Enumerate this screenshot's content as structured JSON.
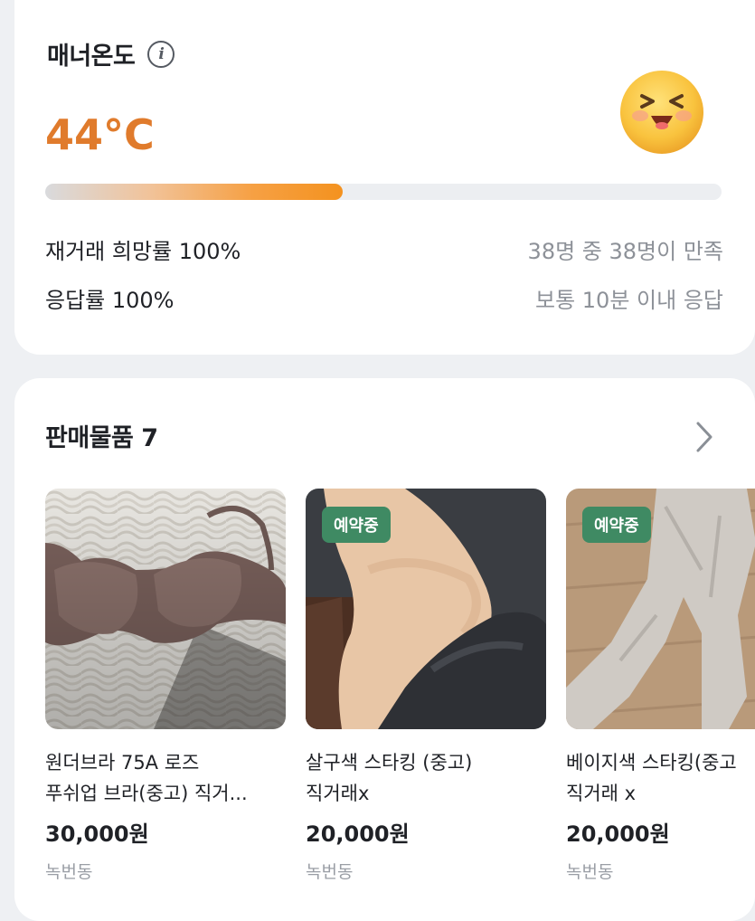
{
  "manner": {
    "title": "매너온도",
    "temperature": "44°C",
    "temperature_level_percent": 44,
    "rows": [
      {
        "label": "재거래 희망률 100%",
        "detail": "38명 중 38명이 만족"
      },
      {
        "label": "응답률 100%",
        "detail": "보통 10분 이내 응답"
      }
    ]
  },
  "sales": {
    "title": "판매물품 7",
    "items": [
      {
        "title_line1": "원더브라 75A 로즈",
        "title_line2": "푸쉬업 브라(중고) 직거...",
        "price": "30,000원",
        "location": "녹번동",
        "badge": ""
      },
      {
        "title_line1": "살구색 스타킹 (중고)",
        "title_line2": "직거래x",
        "price": "20,000원",
        "location": "녹번동",
        "badge": "예약중"
      },
      {
        "title_line1": "베이지색 스타킹(중고",
        "title_line2": "직거래 x",
        "price": "20,000원",
        "location": "녹번동",
        "badge": "예약중"
      }
    ]
  },
  "colors": {
    "accent": "#e07b2c",
    "badge": "#3f8a63"
  }
}
